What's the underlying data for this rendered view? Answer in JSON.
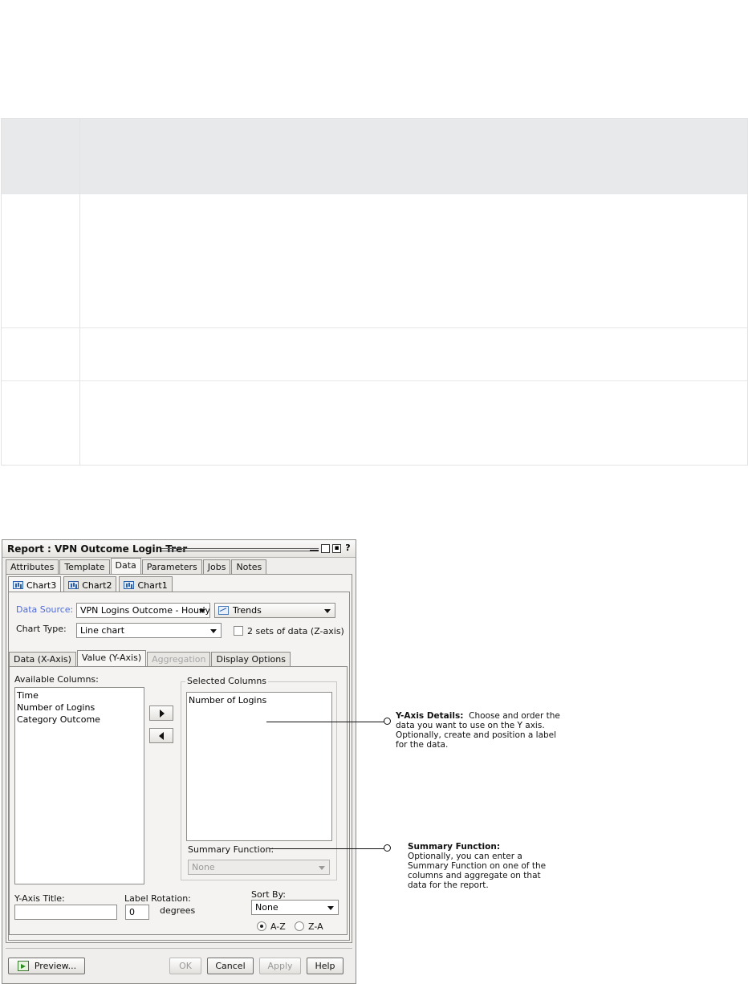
{
  "dialog": {
    "title": "Report : VPN Outcome Login Trer",
    "main_tabs": [
      "Attributes",
      "Template",
      "Data",
      "Parameters",
      "Jobs",
      "Notes"
    ],
    "chart_tabs": [
      "Chart3",
      "Chart2",
      "Chart1"
    ],
    "data_source_label": "Data Source:",
    "data_source_value": "VPN Logins Outcome - Hourly",
    "trends_value": "Trends",
    "chart_type_label": "Chart Type:",
    "chart_type_value": "Line chart",
    "zaxis_label": "2 sets of data (Z-axis)",
    "sub_tabs": [
      "Data (X-Axis)",
      "Value (Y-Axis)",
      "Aggregation",
      "Display Options"
    ],
    "available_columns_label": "Available Columns:",
    "available_columns": [
      "Time",
      "Number of Logins",
      "Category Outcome"
    ],
    "selected_columns_label": "Selected Columns",
    "selected_columns": [
      "Number of Logins"
    ],
    "summary_function_label": "Summary Function:",
    "summary_function_value": "None",
    "yaxis_title_label": "Y-Axis Title:",
    "yaxis_title_value": "",
    "label_rotation_label": "Label Rotation:",
    "label_rotation_value": "0",
    "degrees_label": "degrees",
    "sort_by_label": "Sort By:",
    "sort_by_value": "None",
    "sort_az": "A-Z",
    "sort_za": "Z-A",
    "buttons": {
      "preview": "Preview...",
      "ok": "OK",
      "cancel": "Cancel",
      "apply": "Apply",
      "help": "Help"
    }
  },
  "callouts": {
    "yaxis": {
      "heading": "Y-Axis Details:",
      "body": "Choose and order the data you want to use on the Y axis. Optionally, create and position a label for the data."
    },
    "summary": {
      "heading": "Summary Function:",
      "body": "Optionally, you can enter a Summary Function on one of the columns and aggregate on that data for the report."
    }
  }
}
